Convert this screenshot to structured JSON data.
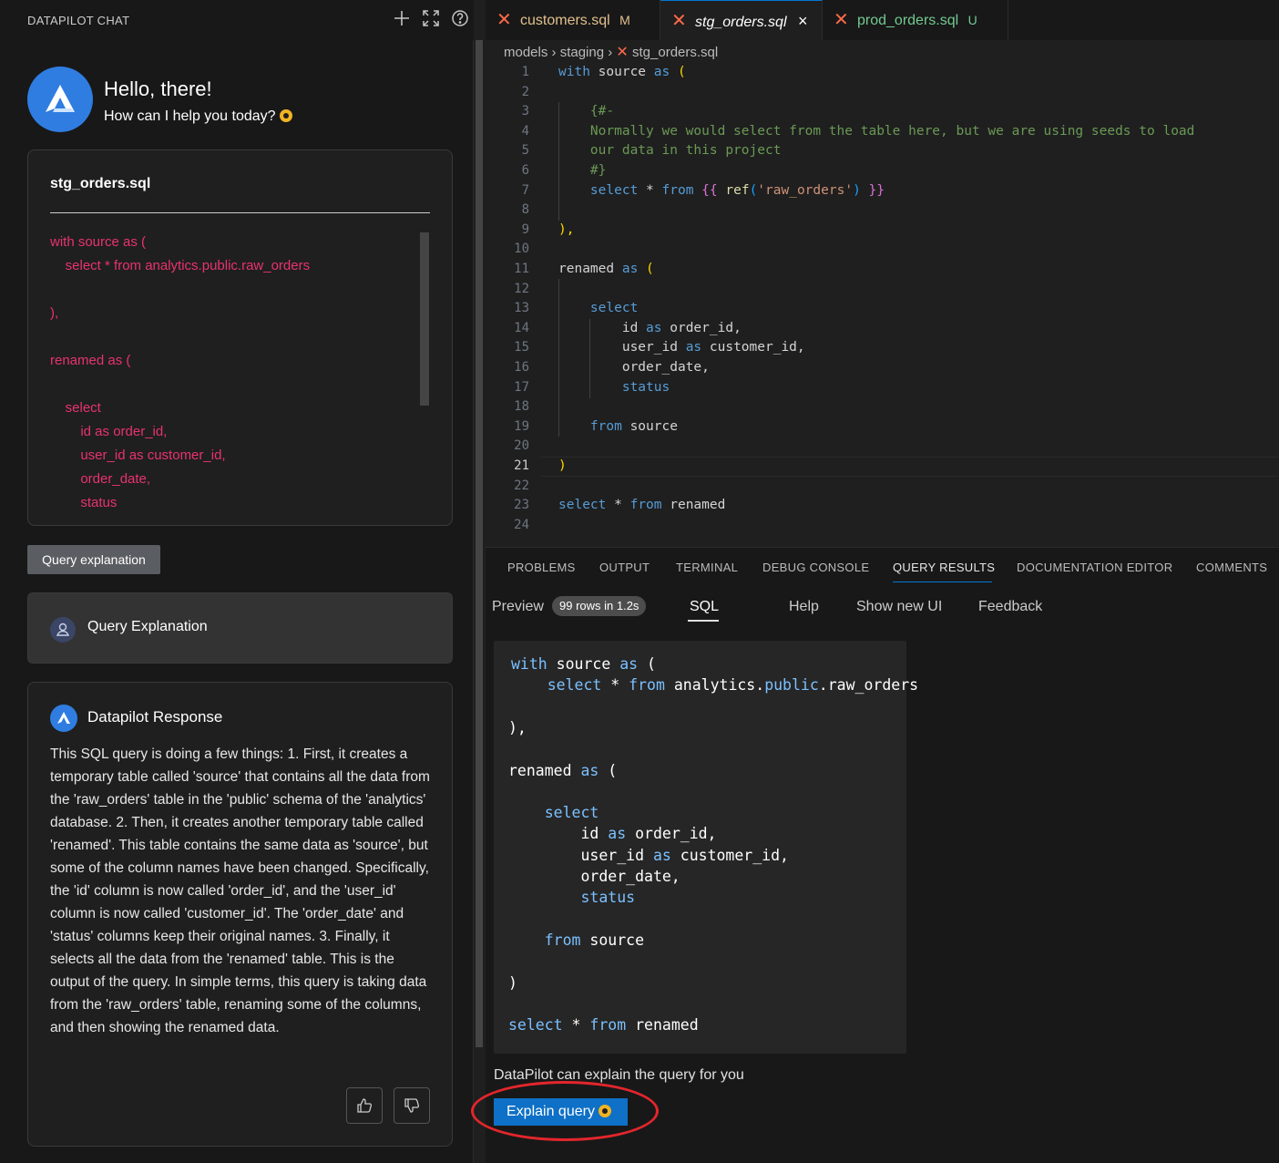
{
  "chat": {
    "header_title": "DATAPILOT CHAT",
    "header_icons": [
      "plus-icon",
      "expand-icon",
      "help-icon"
    ],
    "greeting_title": "Hello, there!",
    "greeting_subtitle": "How can I help you today?",
    "file_card": {
      "title": "stg_orders.sql",
      "code_lines": [
        "with source as (",
        "    select * from analytics.public.raw_orders",
        "",
        "),",
        "",
        "renamed as (",
        "",
        "    select",
        "        id as order_id,",
        "        user_id as customer_id,",
        "        order_date,",
        "        status"
      ]
    },
    "query_explanation_chip": "Query explanation",
    "query_explanation_label": "Query Explanation",
    "response": {
      "title": "Datapilot Response",
      "text": "This SQL query is doing a few things: 1. First, it creates a temporary table called 'source' that contains all the data from the 'raw_orders' table in the 'public' schema of the 'analytics' database. 2. Then, it creates another temporary table called 'renamed'. This table contains the same data as 'source', but some of the column names have been changed. Specifically, the 'id' column is now called 'order_id', and the 'user_id' column is now called 'customer_id'. The 'order_date' and 'status' columns keep their original names. 3. Finally, it selects all the data from the 'renamed' table. This is the output of the query. In simple terms, this query is taking data from the 'raw_orders' table, renaming some of the columns, and then showing the renamed data.",
      "feedback_icons": [
        "thumbs-up-icon",
        "thumbs-down-icon"
      ]
    }
  },
  "editor": {
    "tabs": [
      {
        "label": "customers.sql",
        "status": "M",
        "color": "#e2c08d"
      },
      {
        "label": "stg_orders.sql",
        "status": "×",
        "color": "#ffffff"
      },
      {
        "label": "prod_orders.sql",
        "status": "U",
        "color": "#73c991"
      }
    ],
    "breadcrumb": [
      "models",
      "staging",
      "stg_orders.sql"
    ],
    "line_numbers": [
      "1",
      "2",
      "3",
      "4",
      "5",
      "6",
      "7",
      "8",
      "9",
      "10",
      "11",
      "12",
      "13",
      "14",
      "15",
      "16",
      "17",
      "18",
      "19",
      "20",
      "21",
      "22",
      "23",
      "24"
    ],
    "current_line": "21",
    "code": {
      "l1_a": "with",
      "l1_b": " source ",
      "l1_c": "as",
      "l1_d": " (",
      "l3": "    {#-",
      "l4": "    Normally we would select from the table here, but we are using seeds to load",
      "l5": "    our data in this project",
      "l6": "    #}",
      "l7_a": "    select",
      "l7_b": " * ",
      "l7_c": "from",
      "l7_d": " {{",
      "l7_e": " ref",
      "l7_f": "(",
      "l7_g": "'raw_orders'",
      "l7_h": ")",
      "l7_i": " }}",
      "l9": "),",
      "l11_a": "renamed ",
      "l11_b": "as",
      "l11_c": " (",
      "l13": "    select",
      "l14_a": "        id ",
      "l14_b": "as",
      "l14_c": " order_id,",
      "l15_a": "        user_id ",
      "l15_b": "as",
      "l15_c": " customer_id,",
      "l16": "        order_date,",
      "l17": "        status",
      "l19_a": "    from",
      "l19_b": " source",
      "l21": ")",
      "l23_a": "select",
      "l23_b": " * ",
      "l23_c": "from",
      "l23_d": " renamed"
    }
  },
  "panel": {
    "tabs": [
      "PROBLEMS",
      "OUTPUT",
      "TERMINAL",
      "DEBUG CONSOLE",
      "QUERY RESULTS",
      "DOCUMENTATION EDITOR",
      "COMMENTS"
    ],
    "active_tab": "QUERY RESULTS",
    "subtabs": {
      "preview": "Preview",
      "rows_badge": "99 rows in 1.2s",
      "sql": "SQL",
      "help": "Help",
      "show_new_ui": "Show new UI",
      "feedback": "Feedback"
    },
    "sql": {
      "s1_a": "with",
      "s1_b": " source ",
      "s1_c": "as",
      "s1_d": " (",
      "s2_a": "    select",
      "s2_b": " * ",
      "s2_c": "from",
      "s2_d": " analytics.",
      "s2_e": "public",
      "s2_f": ".raw_orders",
      "s4": "),",
      "s6_a": "renamed ",
      "s6_b": "as",
      "s6_c": " (",
      "s8": "    select",
      "s9_a": "        id ",
      "s9_b": "as",
      "s9_c": " order_id,",
      "s10_a": "        user_id ",
      "s10_b": "as",
      "s10_c": " customer_id,",
      "s11": "        order_date,",
      "s12": "        status",
      "s14_a": "    from",
      "s14_b": " source",
      "s16": ")",
      "s18_a": "select",
      "s18_b": " * ",
      "s18_c": "from",
      "s18_d": " renamed"
    },
    "explain_hint": "DataPilot can explain the query for you",
    "explain_button": "Explain query"
  }
}
